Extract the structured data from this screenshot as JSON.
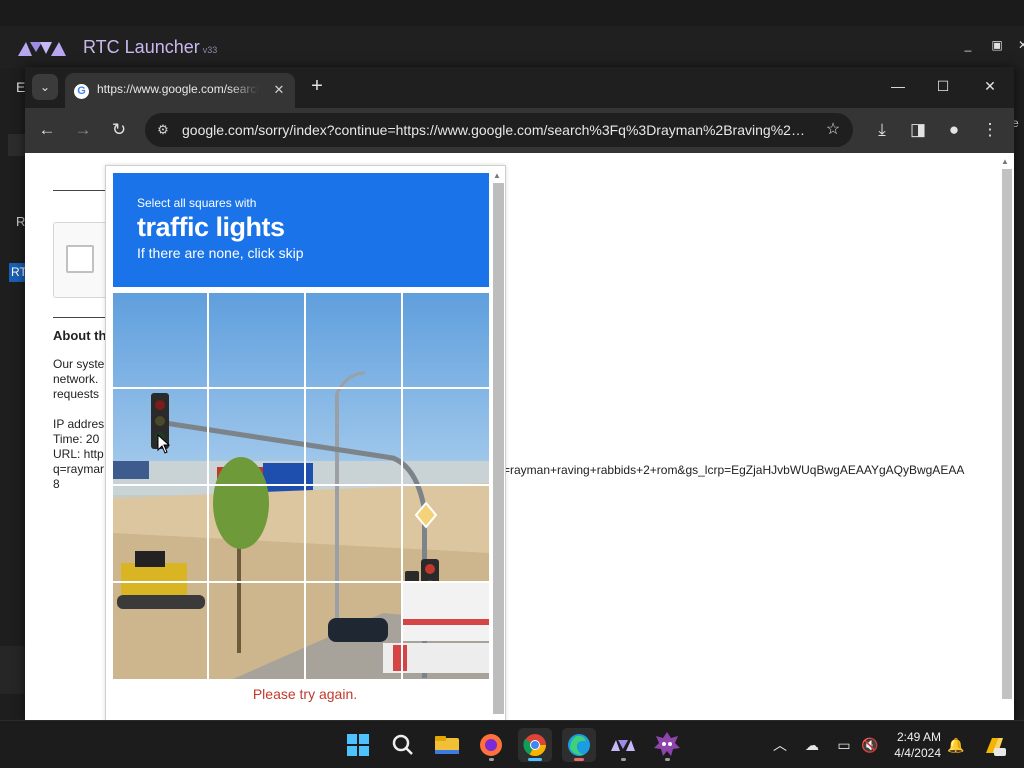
{
  "launcher": {
    "title": "RTC Launcher",
    "version": "v33",
    "side_e": "E",
    "side_r": "R",
    "side_rt": "RT",
    "right_e": "e"
  },
  "browser": {
    "tab_title": "https://www.google.com/search",
    "address": "google.com/sorry/index?continue=https://www.google.com/search%3Fq%3Drayman%2Braving%2Br...",
    "page": {
      "about_heading": "About th",
      "para_lines": [
        "Our syste",
        "network.",
        "requests"
      ],
      "info_lines": [
        "IP addres",
        "Time: 20",
        "URL: http",
        "q=raymar",
        "8"
      ],
      "url_continuation": "=rayman+raving+rabbids+2+rom&gs_lcrp=EgZjaHJvbWUqBwgAEAAYgAQyBwgAEAA"
    }
  },
  "captcha": {
    "instruction": "Select all squares with",
    "object": "traffic lights",
    "sub": "If there are none, click skip",
    "error": "Please try again.",
    "grid_cols": 4,
    "grid_rows": 4
  },
  "taskbar": {
    "icons": [
      "windows-start",
      "search",
      "file-explorer",
      "firefox",
      "chrome",
      "edge",
      "rtc-launcher",
      "game"
    ],
    "time": "2:49 AM",
    "date": "4/4/2024"
  }
}
